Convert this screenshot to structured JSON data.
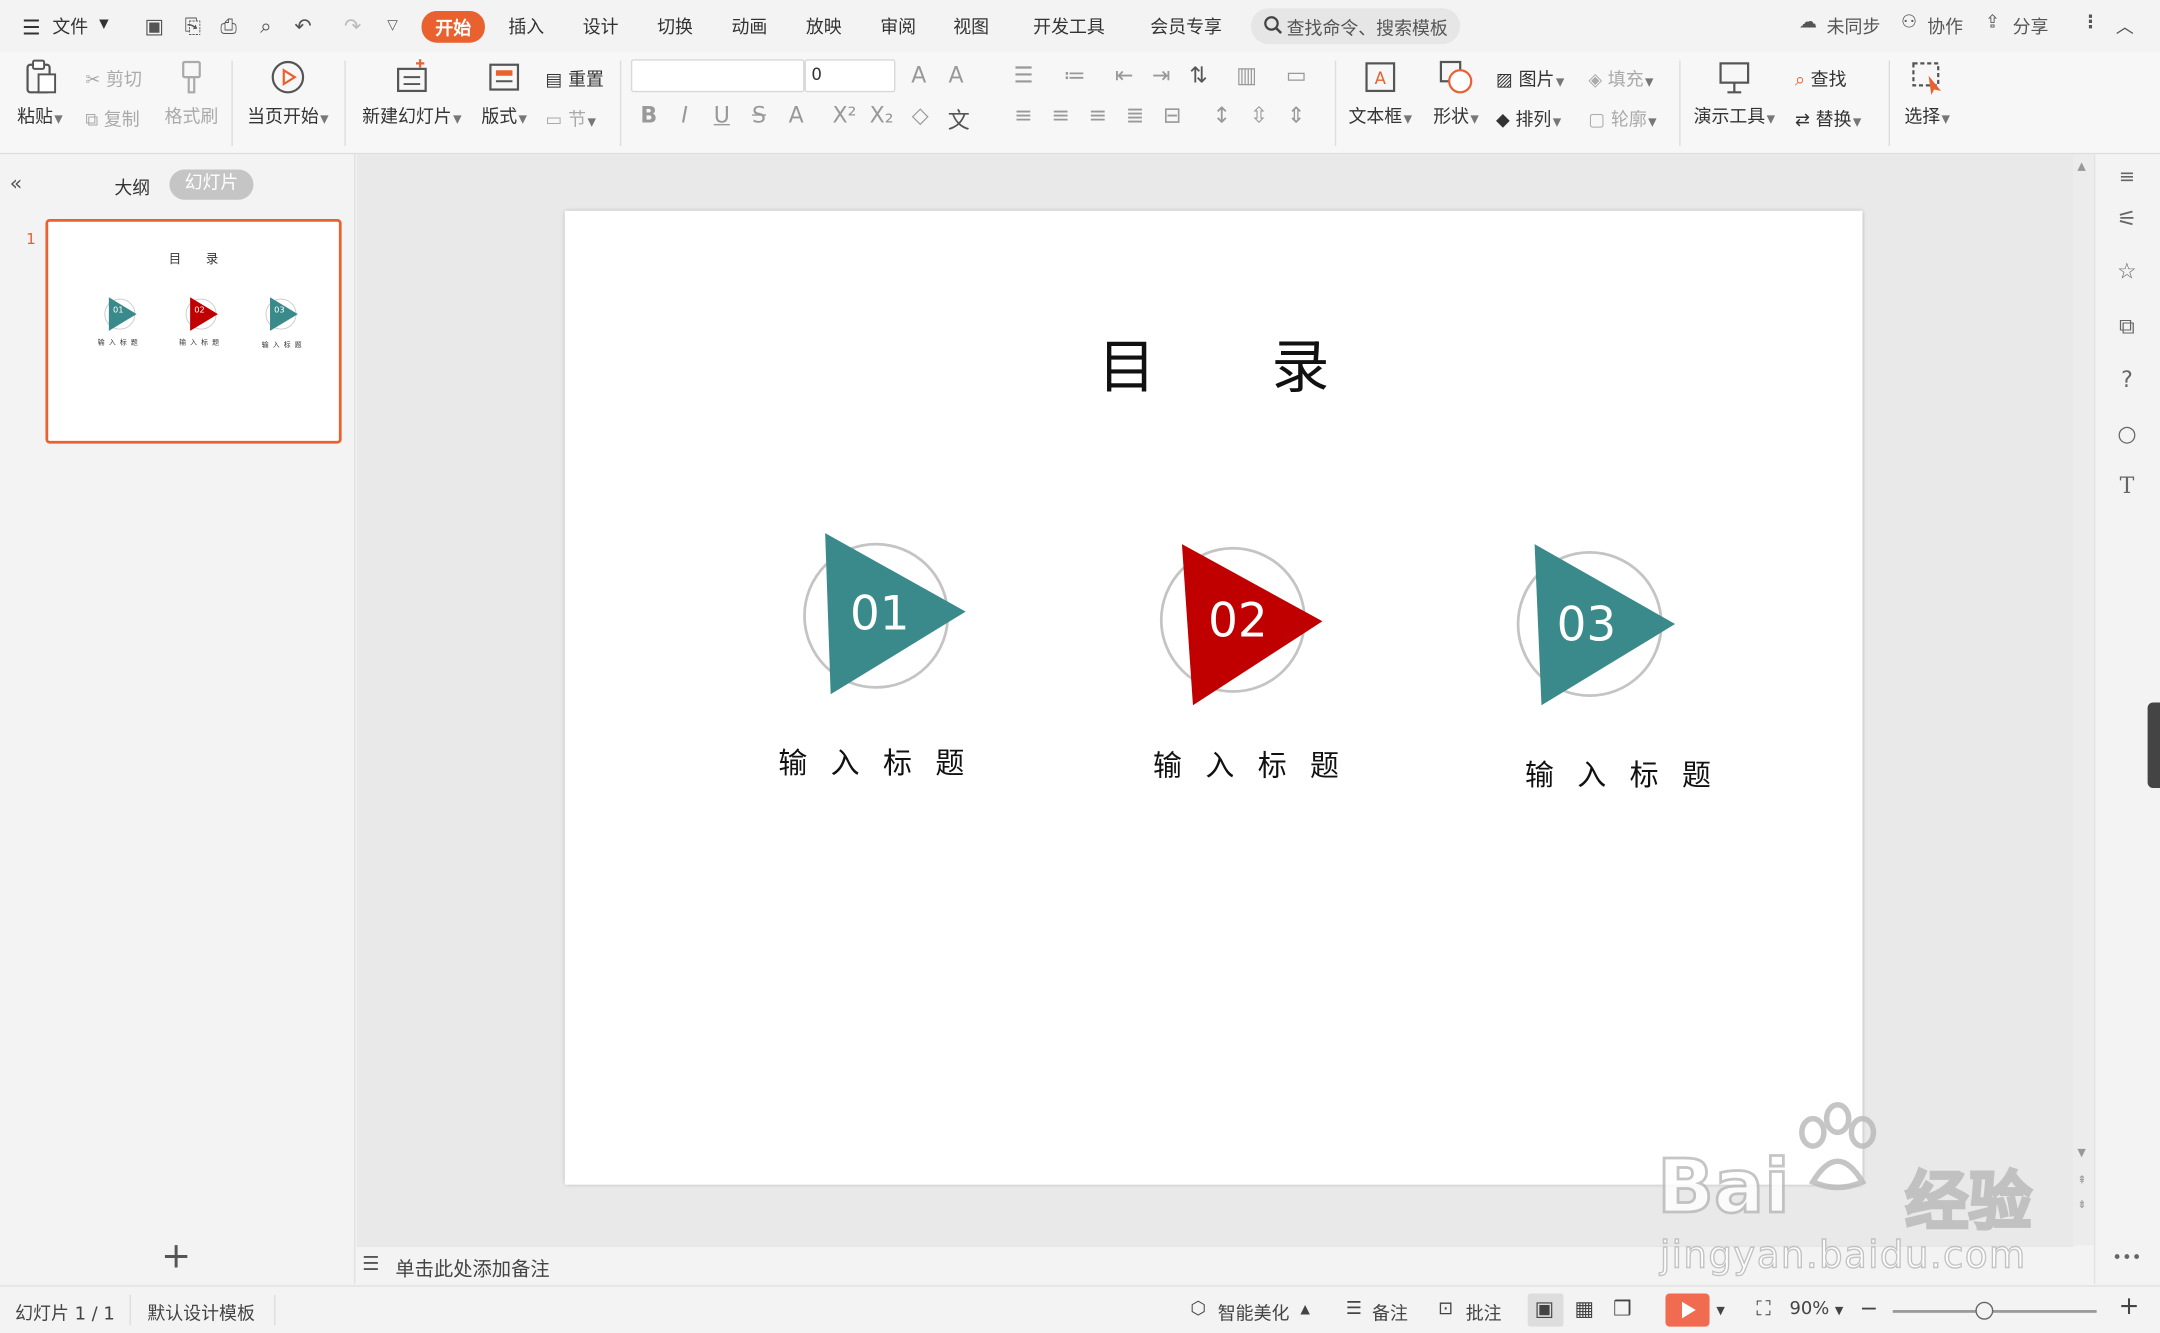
{
  "menu": {
    "file": "文件",
    "tabs": [
      "开始",
      "插入",
      "设计",
      "切换",
      "动画",
      "放映",
      "审阅",
      "视图",
      "开发工具",
      "会员专享"
    ],
    "active_tab": "开始",
    "search_placeholder": "查找命令、搜索模板",
    "sync": "未同步",
    "collab": "协作",
    "share": "分享"
  },
  "ribbon": {
    "paste": "粘贴",
    "cut": "剪切",
    "copy": "复制",
    "format_painter": "格式刷",
    "from_current": "当页开始",
    "new_slide": "新建幻灯片",
    "layout": "版式",
    "reset": "重置",
    "section": "节",
    "font_name": "",
    "font_size": "0",
    "textbox": "文本框",
    "shape": "形状",
    "picture": "图片",
    "fill": "填充",
    "arrange": "排列",
    "outline": "轮廓",
    "presenter_tools": "演示工具",
    "find": "查找",
    "replace": "替换",
    "select": "选择"
  },
  "left_panel": {
    "tab_outline": "大纲",
    "tab_slides": "幻灯片",
    "slide_number": "1"
  },
  "slide": {
    "title": "目　　录",
    "items": [
      {
        "num": "01",
        "label": "输入标题",
        "color": "#3a8a8c"
      },
      {
        "num": "02",
        "label": "输入标题",
        "color": "#c00000"
      },
      {
        "num": "03",
        "label": "输入标题",
        "color": "#3a8a8c"
      }
    ]
  },
  "notes_placeholder": "单击此处添加备注",
  "status": {
    "slide_count": "幻灯片 1 / 1",
    "template": "默认设计模板",
    "beautify": "智能美化",
    "notes": "备注",
    "comments": "批注",
    "zoom": "90%"
  },
  "colors": {
    "accent": "#e8612f",
    "teal": "#3a8a8c",
    "red": "#c00000",
    "play": "#f06b4f"
  },
  "watermark": {
    "brand": "Bai",
    "brand2": "经验",
    "url": "jingyan.baidu.com"
  }
}
